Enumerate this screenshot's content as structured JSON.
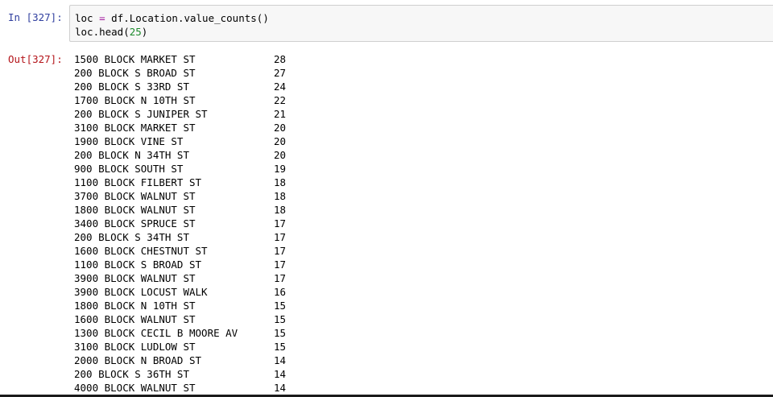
{
  "cell": {
    "in_prompt": "In [327]:",
    "out_prompt": "Out[327]:",
    "code": {
      "line1_lhs": "loc",
      "line1_op": "=",
      "line1_rhs": "df.Location.value_counts()",
      "line2_pre": "loc.head(",
      "line2_num": "25",
      "line2_post": ")"
    },
    "colors": {
      "in_prompt": "#303f9f",
      "out_prompt": "#b4141a",
      "operator": "#a2179e",
      "number": "#1b8a2b",
      "input_background": "#f7f7f7"
    }
  },
  "output_rows": [
    {
      "location": "1500 BLOCK MARKET ST",
      "count": "28"
    },
    {
      "location": "200 BLOCK S BROAD ST",
      "count": "27"
    },
    {
      "location": "200 BLOCK S 33RD ST",
      "count": "24"
    },
    {
      "location": "1700 BLOCK N 10TH ST",
      "count": "22"
    },
    {
      "location": "200 BLOCK S JUNIPER ST",
      "count": "21"
    },
    {
      "location": "3100 BLOCK MARKET ST",
      "count": "20"
    },
    {
      "location": "1900 BLOCK VINE ST",
      "count": "20"
    },
    {
      "location": "200 BLOCK N 34TH ST",
      "count": "20"
    },
    {
      "location": "900 BLOCK SOUTH ST",
      "count": "19"
    },
    {
      "location": "1100 BLOCK FILBERT ST",
      "count": "18"
    },
    {
      "location": "3700 BLOCK WALNUT ST",
      "count": "18"
    },
    {
      "location": "1800 BLOCK WALNUT ST",
      "count": "18"
    },
    {
      "location": "3400 BLOCK SPRUCE ST",
      "count": "17"
    },
    {
      "location": "200 BLOCK S 34TH ST",
      "count": "17"
    },
    {
      "location": "1600 BLOCK CHESTNUT ST",
      "count": "17"
    },
    {
      "location": "1100 BLOCK S BROAD ST",
      "count": "17"
    },
    {
      "location": "3900 BLOCK WALNUT ST",
      "count": "17"
    },
    {
      "location": "3900 BLOCK LOCUST WALK",
      "count": "16"
    },
    {
      "location": "1800 BLOCK N 10TH ST",
      "count": "15"
    },
    {
      "location": "1600 BLOCK WALNUT ST",
      "count": "15"
    },
    {
      "location": "1300 BLOCK CECIL B MOORE AV",
      "count": "15"
    },
    {
      "location": "3100 BLOCK LUDLOW ST",
      "count": "15"
    },
    {
      "location": "2000 BLOCK N BROAD ST",
      "count": "14"
    },
    {
      "location": "200 BLOCK S 36TH ST",
      "count": "14"
    },
    {
      "location": "4000 BLOCK WALNUT ST",
      "count": "14"
    }
  ]
}
